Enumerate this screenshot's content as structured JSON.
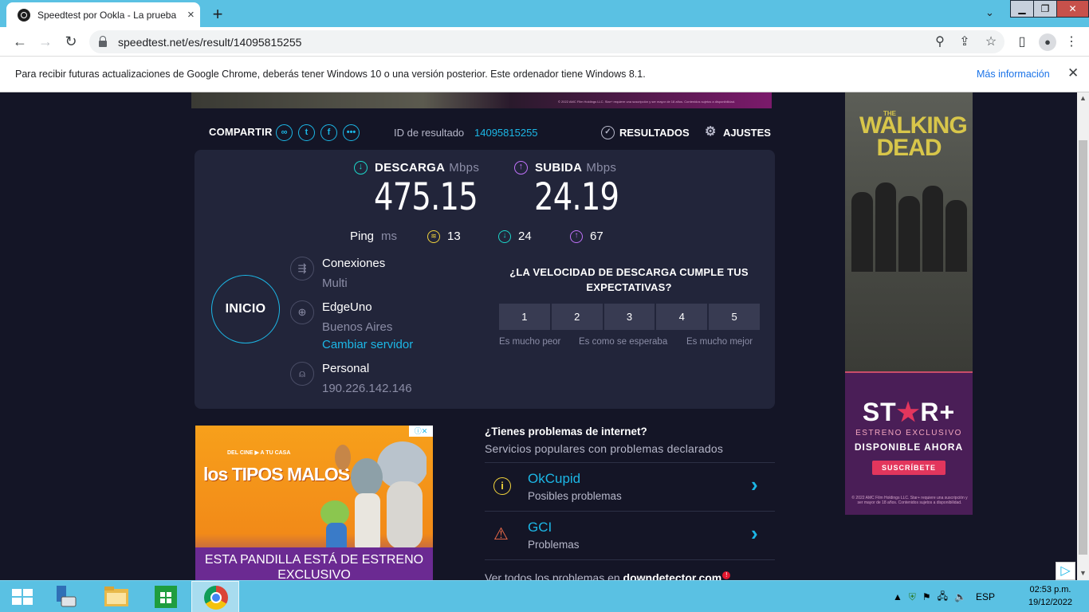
{
  "browser": {
    "tab_title": "Speedtest por Ookla - La prueba",
    "tab_close": "×",
    "new_tab": "+",
    "url": "speedtest.net/es/result/14095815255",
    "infobar_message": "Para recibir futuras actualizaciones de Google Chrome, deberás tener Windows 10 o una versión posterior. Este ordenador tiene Windows 8.1.",
    "infobar_link": "Más información",
    "infobar_close": "✕"
  },
  "share": {
    "label": "COMPARTIR",
    "result_id_label": "ID de resultado",
    "result_id": "14095815255",
    "results_label": "RESULTADOS",
    "settings_label": "AJUSTES"
  },
  "result": {
    "download_label": "DESCARGA",
    "upload_label": "SUBIDA",
    "unit": "Mbps",
    "download_value": "475.15",
    "upload_value": "24.19",
    "ping_label": "Ping",
    "ping_unit": "ms",
    "ping_idle": "13",
    "ping_download": "24",
    "ping_upload": "67",
    "go_label": "INICIO",
    "connections_title": "Conexiones",
    "connections_value": "Multi",
    "server_name": "EdgeUno",
    "server_location": "Buenos Aires",
    "change_server": "Cambiar servidor",
    "isp_name": "Personal",
    "ip": "190.226.142.146"
  },
  "survey": {
    "question": "¿LA VELOCIDAD DE DESCARGA CUMPLE TUS EXPECTATIVAS?",
    "options": [
      "1",
      "2",
      "3",
      "4",
      "5"
    ],
    "label_low": "Es mucho peor",
    "label_mid": "Es como se esperaba",
    "label_high": "Es mucho mejor"
  },
  "problems": {
    "title": "¿Tienes problemas de internet?",
    "subtitle": "Servicios populares con problemas declarados",
    "items": [
      {
        "name": "OkCupid",
        "status": "Posibles problemas"
      },
      {
        "name": "GCI",
        "status": "Problemas"
      }
    ],
    "footer_prefix": "Ver todos los problemas en",
    "footer_site": "downdetector.com"
  },
  "ads": {
    "left_top": "DEL CINE ▶ A TU CASA",
    "left_logo": "los TIPOS MALOS",
    "left_strip": "ESTA PANDILLA ESTÁ DE ESTRENO EXCLUSIVO",
    "right_the": "THE",
    "right_title": "WALKING DEAD",
    "right_brand_a": "ST",
    "right_brand_star": "★",
    "right_brand_b": "R+",
    "right_exclusive": "ESTRENO EXCLUSIVO",
    "right_available": "DISPONIBLE AHORA",
    "right_cta": "SUSCRÍBETE",
    "right_legal": "© 2022 AMC Film Holdings LLC. Star+ requiere una suscripción y ser mayor de 18 años. Contenidos sujetos a disponibilidad.",
    "top_legal": "© 2022 AMC Film Holdings LLC. Star+ requiere una suscripción y ser mayor de 18 años. Contenidos sujetos a disponibilidad."
  },
  "taskbar": {
    "language": "ESP",
    "time": "02:53 p.m.",
    "date": "19/12/2022"
  }
}
